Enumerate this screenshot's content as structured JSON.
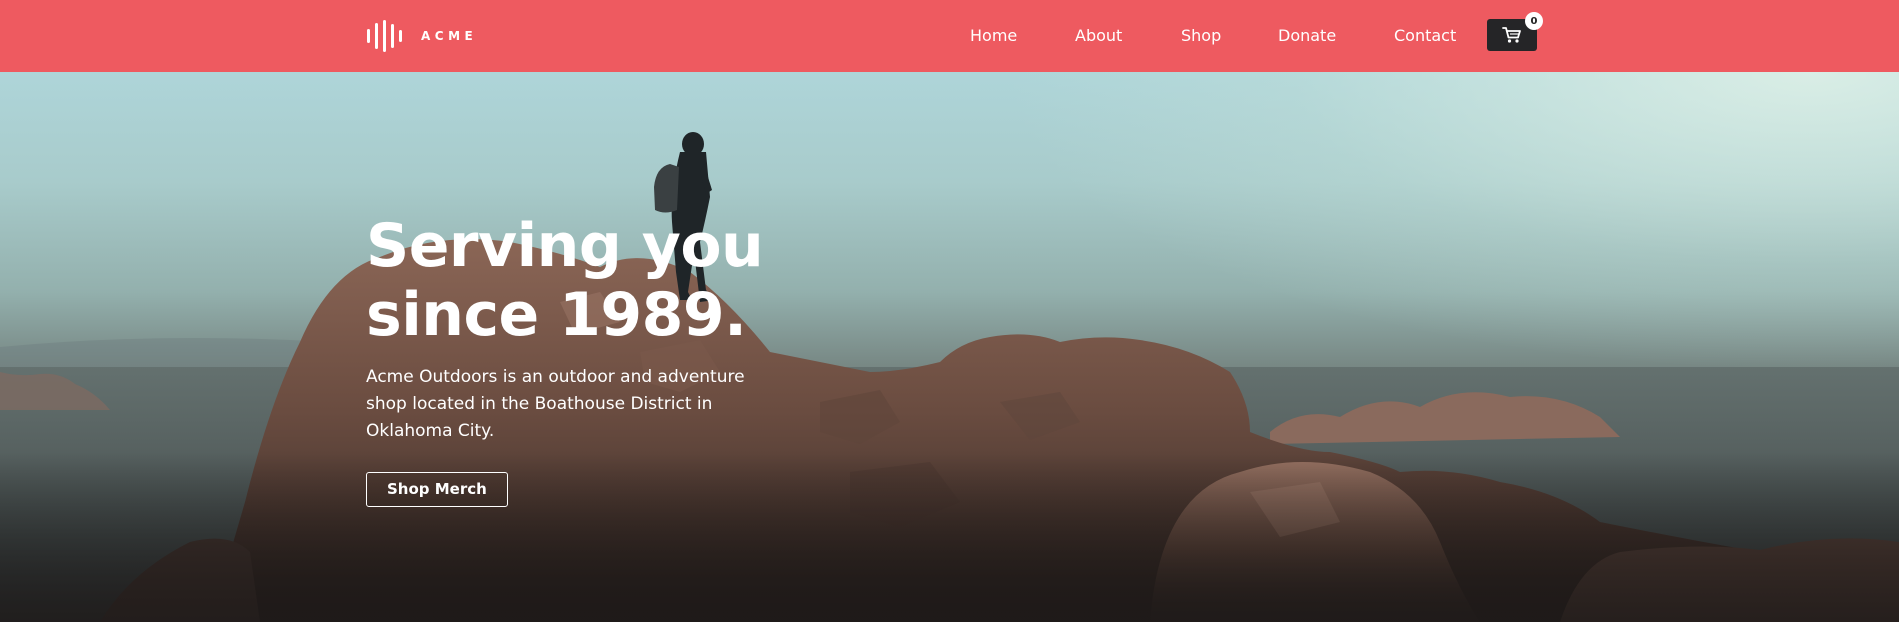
{
  "brand": {
    "name": "ACME",
    "logo_icon": "sound-wave-bars-icon"
  },
  "nav": {
    "items": [
      {
        "label": "Home"
      },
      {
        "label": "About"
      },
      {
        "label": "Shop"
      },
      {
        "label": "Donate"
      },
      {
        "label": "Contact"
      }
    ],
    "cart": {
      "icon": "shopping-cart-icon",
      "count": "0"
    }
  },
  "hero": {
    "title_line_1": "Serving you",
    "title_line_2": "since 1989.",
    "description": "Acme Outdoors is an outdoor and adventure shop located in the Boathouse District in Oklahoma City.",
    "cta_label": "Shop Merch"
  },
  "colors": {
    "navbar_background": "#ee5a60",
    "cart_button_background": "#252527",
    "text_on_dark": "#ffffff"
  }
}
